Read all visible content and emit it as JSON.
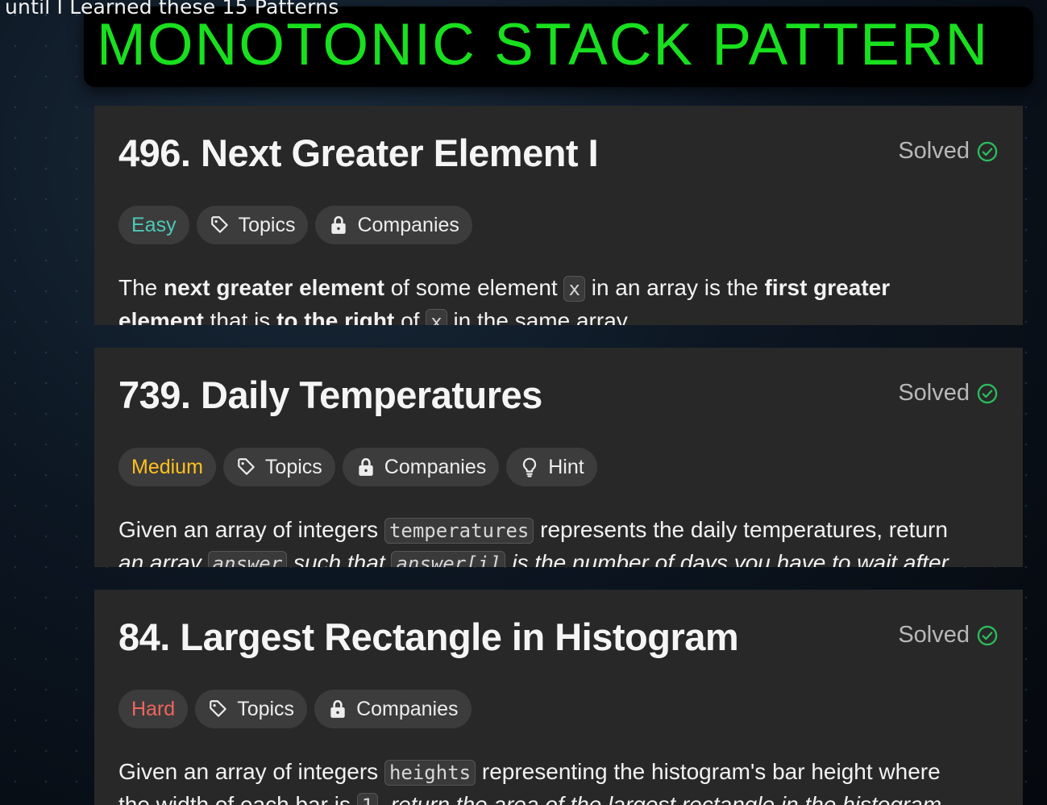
{
  "overlay": {
    "caption": "until I Learned these 15 Patterns",
    "banner_title": "MONOTONIC STACK PATTERN"
  },
  "colors": {
    "banner_text": "#18e01e",
    "easy": "#4ec9b8",
    "medium": "#ffc01e",
    "hard": "#f0645f",
    "solved_check": "#2cbb5d",
    "card_bg": "#282828"
  },
  "problems": [
    {
      "title": "496. Next Greater Element I",
      "status": "Solved",
      "difficulty": "Easy",
      "tags": [
        "Topics",
        "Companies"
      ],
      "desc": {
        "l1_a": "The ",
        "l1_b": "next greater element",
        "l1_c": " of some element ",
        "l1_code": "x",
        "l1_d": " in an array is the ",
        "l1_e": "first greater",
        "l2_a": "element",
        "l2_b": " that is ",
        "l2_c": "to the right",
        "l2_d": " of ",
        "l2_code": "x",
        "l2_e": " in the same array."
      }
    },
    {
      "title": "739. Daily Temperatures",
      "status": "Solved",
      "difficulty": "Medium",
      "tags": [
        "Topics",
        "Companies",
        "Hint"
      ],
      "desc": {
        "l1_a": "Given an array of integers ",
        "l1_code": "temperatures",
        "l1_b": " represents the daily temperatures, return",
        "l2_a": "an array ",
        "l2_code1": "answer",
        "l2_b": " such that ",
        "l2_code2": "answer[i]",
        "l2_c": " is the number of days you have to wait after"
      }
    },
    {
      "title": "84. Largest Rectangle in Histogram",
      "status": "Solved",
      "difficulty": "Hard",
      "tags": [
        "Topics",
        "Companies"
      ],
      "desc": {
        "l1_a": "Given an array of integers ",
        "l1_code": "heights",
        "l1_b": " representing the histogram's bar height where",
        "l2_a": "the width of each bar is ",
        "l2_code": "1",
        "l2_b": ", return the area of the largest rectangle in the histogram."
      }
    }
  ]
}
